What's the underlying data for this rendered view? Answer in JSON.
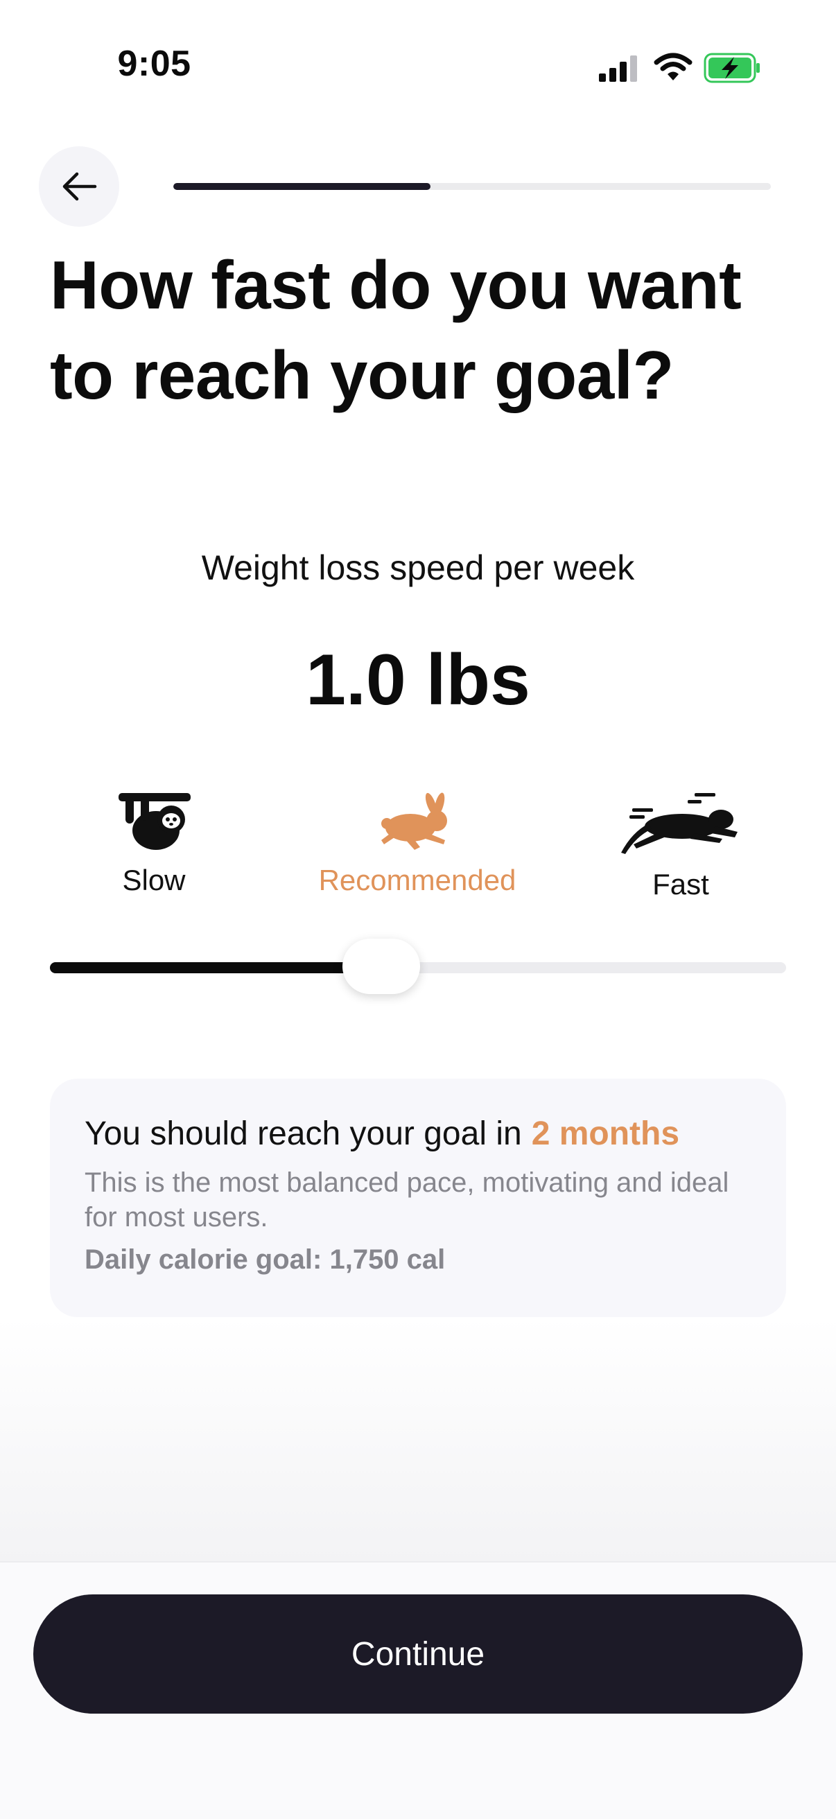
{
  "status_bar": {
    "time": "9:05",
    "icons": [
      "cellular-signal-icon",
      "wifi-icon",
      "battery-charging-icon"
    ],
    "battery_color": "#34c759"
  },
  "header": {
    "back_icon": "arrow-left-icon",
    "progress_fraction": 0.43
  },
  "title": "How fast do you want to reach your goal?",
  "speed": {
    "label": "Weight loss speed per week",
    "value": "1.0 lbs",
    "options": [
      {
        "label": "Slow",
        "icon": "sloth-icon",
        "active": false
      },
      {
        "label": "Recommended",
        "icon": "rabbit-icon",
        "active": true
      },
      {
        "label": "Fast",
        "icon": "panther-icon",
        "active": false
      }
    ],
    "slider_fraction": 0.45
  },
  "goal_card": {
    "headline": "You should reach your goal in",
    "highlight": "2 months",
    "description": "This is the most balanced pace, motivating and ideal for most users.",
    "calorie": "Daily calorie goal: 1,750 cal"
  },
  "footer": {
    "continue_label": "Continue"
  },
  "colors": {
    "accent": "#e0935a",
    "dark": "#1c1a27",
    "card_bg": "#f7f7fb"
  }
}
